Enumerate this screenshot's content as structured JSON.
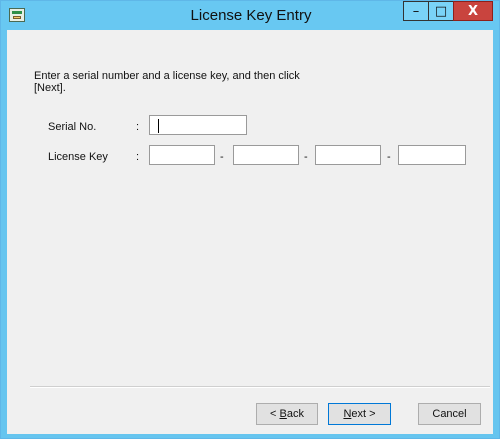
{
  "window": {
    "title": "License Key Entry",
    "controls": {
      "minimize": "–",
      "maximize": "□",
      "close": "X"
    }
  },
  "content": {
    "intro": "Enter a serial number and a license key, and then click [Next].",
    "serial": {
      "label": "Serial No.",
      "colon": ":",
      "value": ""
    },
    "license": {
      "label": "License Key",
      "colon": ":",
      "segments": [
        "",
        "",
        "",
        ""
      ],
      "separator": "-"
    }
  },
  "buttons": {
    "back_accel": "B",
    "back_rest": "ack",
    "back_prefix": "< ",
    "next_accel": "N",
    "next_rest": "ext >",
    "cancel": "Cancel"
  },
  "colors": {
    "titlebar": "#68c8f2",
    "close": "#c9443e",
    "dialog": "#f0f0f0"
  },
  "icons": {
    "app": "application-icon"
  }
}
